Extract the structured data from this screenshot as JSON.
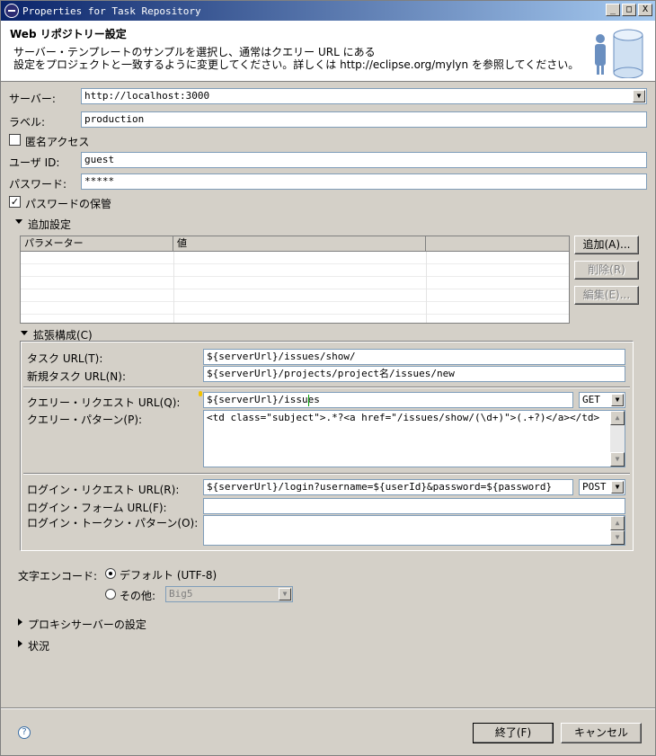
{
  "window": {
    "title": "Properties for Task Repository",
    "controls": {
      "minimize": "_",
      "maximize": "□",
      "close": "X"
    }
  },
  "banner": {
    "title": "Web リポジトリー設定",
    "description": "サーバー・テンプレートのサンプルを選択し、通常はクエリー URL にある\n設定をプロジェクトと一致するように変更してください。詳しくは http://eclipse.org/mylyn を参照してください。"
  },
  "form": {
    "server_label": "サーバー:",
    "server_value": "http://localhost:3000",
    "label_label": "ラベル:",
    "label_value": "production",
    "anonymous_label": "匿名アクセス",
    "anonymous_checked": false,
    "user_id_label": "ユーザ ID:",
    "user_id_value": "guest",
    "password_label": "パスワード:",
    "password_value": "*****",
    "save_password_label": "パスワードの保管",
    "save_password_checked": true
  },
  "additional": {
    "section_label": "追加設定",
    "columns": [
      "パラメーター",
      "値",
      ""
    ],
    "add_button": "追加(A)...",
    "remove_button": "削除(R)",
    "edit_button": "編集(E)..."
  },
  "advanced": {
    "section_label": "拡張構成(C)",
    "task_url_label": "タスク URL(T):",
    "task_url_value": "${serverUrl}/issues/show/",
    "new_task_url_label": "新規タスク URL(N):",
    "new_task_url_value": "${serverUrl}/projects/project名/issues/new",
    "query_request_url_label": "クエリー・リクエスト URL(Q):",
    "query_request_url_value": "${serverUrl}/issues",
    "query_method": "GET",
    "query_pattern_label": "クエリー・パターン(P):",
    "query_pattern_value": "<td class=\"subject\">.*?<a href=\"/issues/show/(\\d+)\">(.+?)</a></td>",
    "login_request_url_label": "ログイン・リクエスト URL(R):",
    "login_request_url_value": "${serverUrl}/login?username=${userId}&password=${password}",
    "login_method": "POST",
    "login_form_url_label": "ログイン・フォーム URL(F):",
    "login_form_url_value": "",
    "login_token_pattern_label": "ログイン・トークン・パターン(O):",
    "login_token_pattern_value": ""
  },
  "encoding": {
    "label": "文字エンコード:",
    "default_label": "デフォルト (UTF-8)",
    "default_selected": true,
    "other_label": "その他:",
    "other_value": "Big5"
  },
  "sections": {
    "proxy_label": "プロキシサーバーの設定",
    "status_label": "状況"
  },
  "footer": {
    "finish_button": "終了(F)",
    "cancel_button": "キャンセル",
    "help_icon_text": "?"
  }
}
